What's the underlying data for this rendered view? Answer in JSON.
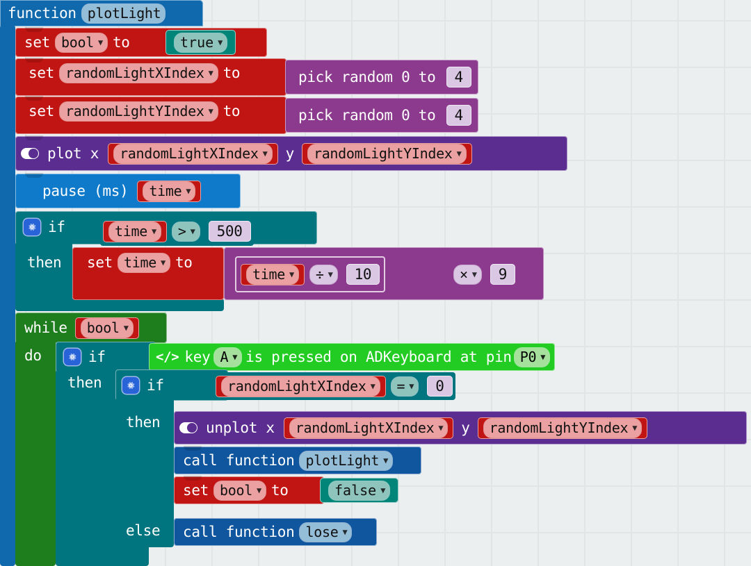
{
  "editor": {
    "background_color": "#eceff0",
    "grid_marker": "plus"
  },
  "program": {
    "function_def": {
      "keyword": "function",
      "name": "plotLight",
      "color": "#1068ad"
    },
    "statements": [
      {
        "id": "set-bool-true",
        "keyword": "set",
        "variable": "bool",
        "to": "to",
        "value": "true",
        "color": "#c01512",
        "value_color": "#008578"
      },
      {
        "id": "set-randomLightXIndex",
        "keyword": "set",
        "variable": "randomLightXIndex",
        "to": "to",
        "value_label": "pick random 0 to",
        "value_number": "4",
        "color": "#c01512",
        "value_color": "#8b3a8e"
      },
      {
        "id": "set-randomLightYIndex",
        "keyword": "set",
        "variable": "randomLightYIndex",
        "to": "to",
        "value_label": "pick random 0 to",
        "value_number": "4",
        "color": "#c01512",
        "value_color": "#8b3a8e"
      },
      {
        "id": "plot",
        "icon": "plot-icon",
        "label": "plot x",
        "arg_x": "randomLightXIndex",
        "label_y": "y",
        "arg_y": "randomLightYIndex",
        "color": "#5b2d90"
      },
      {
        "id": "pause",
        "icon": "led-matrix-icon",
        "label": "pause (ms)",
        "arg": "time",
        "color": "#0e7ac9"
      }
    ],
    "if_block": {
      "keyword": "if",
      "then": "then",
      "color": "#00757f",
      "condition": {
        "left": "time",
        "operator": ">",
        "right": "500",
        "color": "#57a39b"
      },
      "body": {
        "keyword": "set",
        "variable": "time",
        "to": "to",
        "color": "#c01512",
        "expression": {
          "left": "time",
          "op1": "÷",
          "mid": "10",
          "op2": "×",
          "right": "9",
          "color": "#8b3a8e"
        }
      }
    },
    "while_block": {
      "keyword": "while",
      "do": "do",
      "condition": "bool",
      "color": "#1e7e1e",
      "outer_if": {
        "keyword": "if",
        "then": "then",
        "color": "#00757f",
        "condition": {
          "icon": "code-icon",
          "text_1": "key",
          "key": "A",
          "text_2": "is pressed on ADKeyboard at pin",
          "pin": "P0",
          "color": "#22cc22"
        },
        "inner_if": {
          "keyword": "if",
          "then": "then",
          "else": "else",
          "color": "#00757f",
          "condition": {
            "left": "randomLightXIndex",
            "operator": "=",
            "right": "0",
            "color": "#57a39b"
          },
          "then_body": [
            {
              "id": "unplot",
              "icon": "plot-icon",
              "label": "unplot x",
              "arg_x": "randomLightXIndex",
              "label_y": "y",
              "arg_y": "randomLightYIndex",
              "color": "#5b2d90"
            },
            {
              "id": "call-plotLight",
              "label": "call function",
              "func": "plotLight",
              "color": "#10569e"
            },
            {
              "id": "set-bool-false",
              "keyword": "set",
              "variable": "bool",
              "to": "to",
              "value": "false",
              "color": "#c01512",
              "value_color": "#008578"
            }
          ],
          "else_body": [
            {
              "id": "call-lose",
              "label": "call function",
              "func": "lose",
              "color": "#10569e"
            }
          ]
        }
      }
    }
  }
}
